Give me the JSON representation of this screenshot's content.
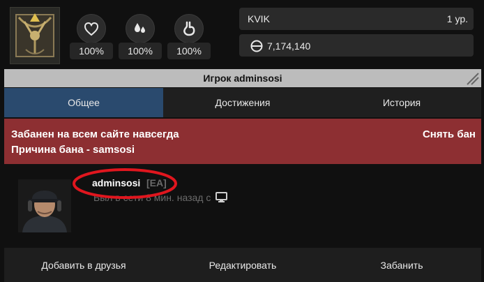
{
  "stats": [
    {
      "icon": "heart-icon",
      "value": "100%"
    },
    {
      "icon": "water-drops-icon",
      "value": "100%"
    },
    {
      "icon": "stomach-icon",
      "value": "100%"
    }
  ],
  "account": {
    "name": "KVIK",
    "level": "1 ур.",
    "balance": "7,174,140"
  },
  "window": {
    "title": "Игрок adminsosi"
  },
  "tabs": [
    "Общее",
    "Достижения",
    "История"
  ],
  "ban": {
    "message": "Забанен на всем сайте навсегда",
    "reason": "Причина бана - samsosi",
    "unban_label": "Снять бан"
  },
  "profile": {
    "username": "adminsosi",
    "tag": "[EA]",
    "last_seen": "Был в сети 8 мин. назад с"
  },
  "actions": [
    "Добавить в друзья",
    "Редактировать",
    "Забанить"
  ],
  "colors": {
    "active_tab": "#2a4a6e",
    "ban_bg": "#8d2f32",
    "annotation": "#e0161e"
  }
}
